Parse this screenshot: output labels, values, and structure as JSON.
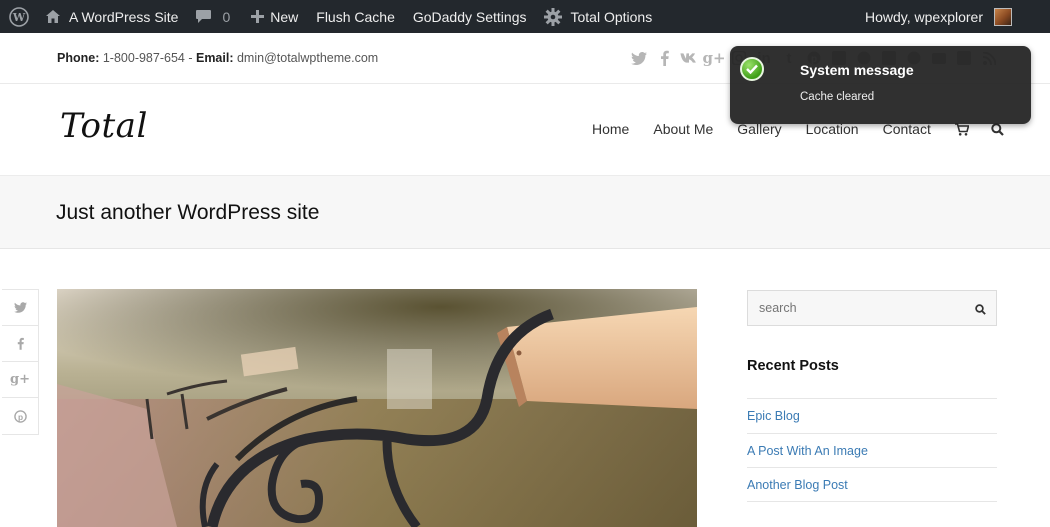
{
  "admin_bar": {
    "site_name": "A WordPress Site",
    "comments_count": "0",
    "new_label": "New",
    "flush_cache_label": "Flush Cache",
    "godaddy_label": "GoDaddy Settings",
    "total_options_label": "Total Options",
    "greeting": "Howdy, wpexplorer",
    "icons": [
      "wordpress-icon",
      "home-icon",
      "comment-icon",
      "plus-icon",
      "gear-icon"
    ]
  },
  "topbar": {
    "phone_label": "Phone:",
    "phone": "1-800-987-654",
    "separator": " - ",
    "email_label": "Email:",
    "email": "dmin@totalwptheme.com",
    "social_icons": [
      "twitter-icon",
      "facebook-icon",
      "vk-icon",
      "google-plus-icon",
      "instagram-icon",
      "linkedin-icon",
      "tumblr-icon",
      "pinterest-icon",
      "flickr-icon",
      "dribbble-icon",
      "rss-feed-icon",
      "skype-icon",
      "youtube-icon",
      "vimeo-icon",
      "rss-icon"
    ]
  },
  "header": {
    "logo": "Total",
    "nav": [
      "Home",
      "About Me",
      "Gallery",
      "Location",
      "Contact"
    ]
  },
  "notification": {
    "title": "System message",
    "message": "Cache cleared"
  },
  "page": {
    "title": "Just another WordPress site"
  },
  "share": {
    "twitter": "🐦",
    "facebook": "f",
    "google": "g+",
    "pinterest": "P"
  },
  "sidebar": {
    "search_placeholder": "search",
    "recent_title": "Recent Posts",
    "recent_posts": [
      "Epic Blog",
      "A Post With An Image",
      "Another Blog Post"
    ]
  },
  "colors": {
    "admin_bar_bg": "#23282d",
    "link": "#3b7bb4",
    "notification_bg": "#202020",
    "success_green": "#3f9e18"
  }
}
